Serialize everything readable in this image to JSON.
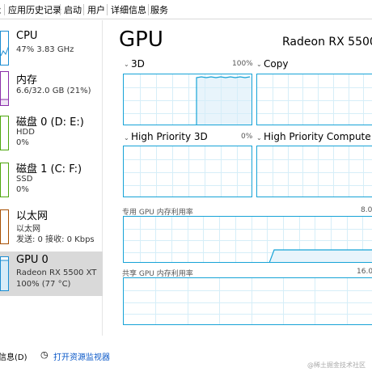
{
  "tabs": [
    "能",
    "应用历史记录",
    "启动",
    "用户",
    "详细信息",
    "服务"
  ],
  "sidebar": {
    "items": [
      {
        "title": "CPU",
        "line1": "47%  3.83 GHz",
        "line2": "",
        "color": "#1a8dd2"
      },
      {
        "title": "内存",
        "line1": "6.6/32.0 GB (21%)",
        "line2": "",
        "color": "#8b2dab"
      },
      {
        "title": "磁盘 0 (D: E:)",
        "line1": "HDD",
        "line2": "0%",
        "color": "#4da60c"
      },
      {
        "title": "磁盘 1 (C: F:)",
        "line1": "SSD",
        "line2": "0%",
        "color": "#4da60c"
      },
      {
        "title": "以太网",
        "line1": "以太网",
        "line2": "发送: 0  接收: 0 Kbps",
        "color": "#a74f01"
      },
      {
        "title": "GPU 0",
        "line1": "Radeon RX 5500 XT",
        "line2": "100% (77 °C)",
        "color": "#1a8dd2"
      }
    ]
  },
  "main": {
    "title": "GPU",
    "device": "Radeon RX 5500",
    "graphs": [
      {
        "label": "3D",
        "pct": "100%",
        "level_after_jump": 1.0
      },
      {
        "label": "Copy",
        "pct": ""
      },
      {
        "label": "High Priority 3D",
        "pct": "0%"
      },
      {
        "label": "High Priority Compute",
        "pct": ""
      }
    ],
    "dedicated_label": "专用 GPU 内存利用率",
    "dedicated_max": "8.0",
    "shared_label": "共享 GPU 内存利用率",
    "shared_max": "16.0"
  },
  "footer": {
    "summary": "信息(D)",
    "open_monitor": "打开资源监视器"
  },
  "watermark": "@稀土掘金技术社区",
  "colors": {
    "gpu_line": "#17a3d7",
    "grid": "#d6eef8",
    "fill": "#e8f4fb"
  }
}
